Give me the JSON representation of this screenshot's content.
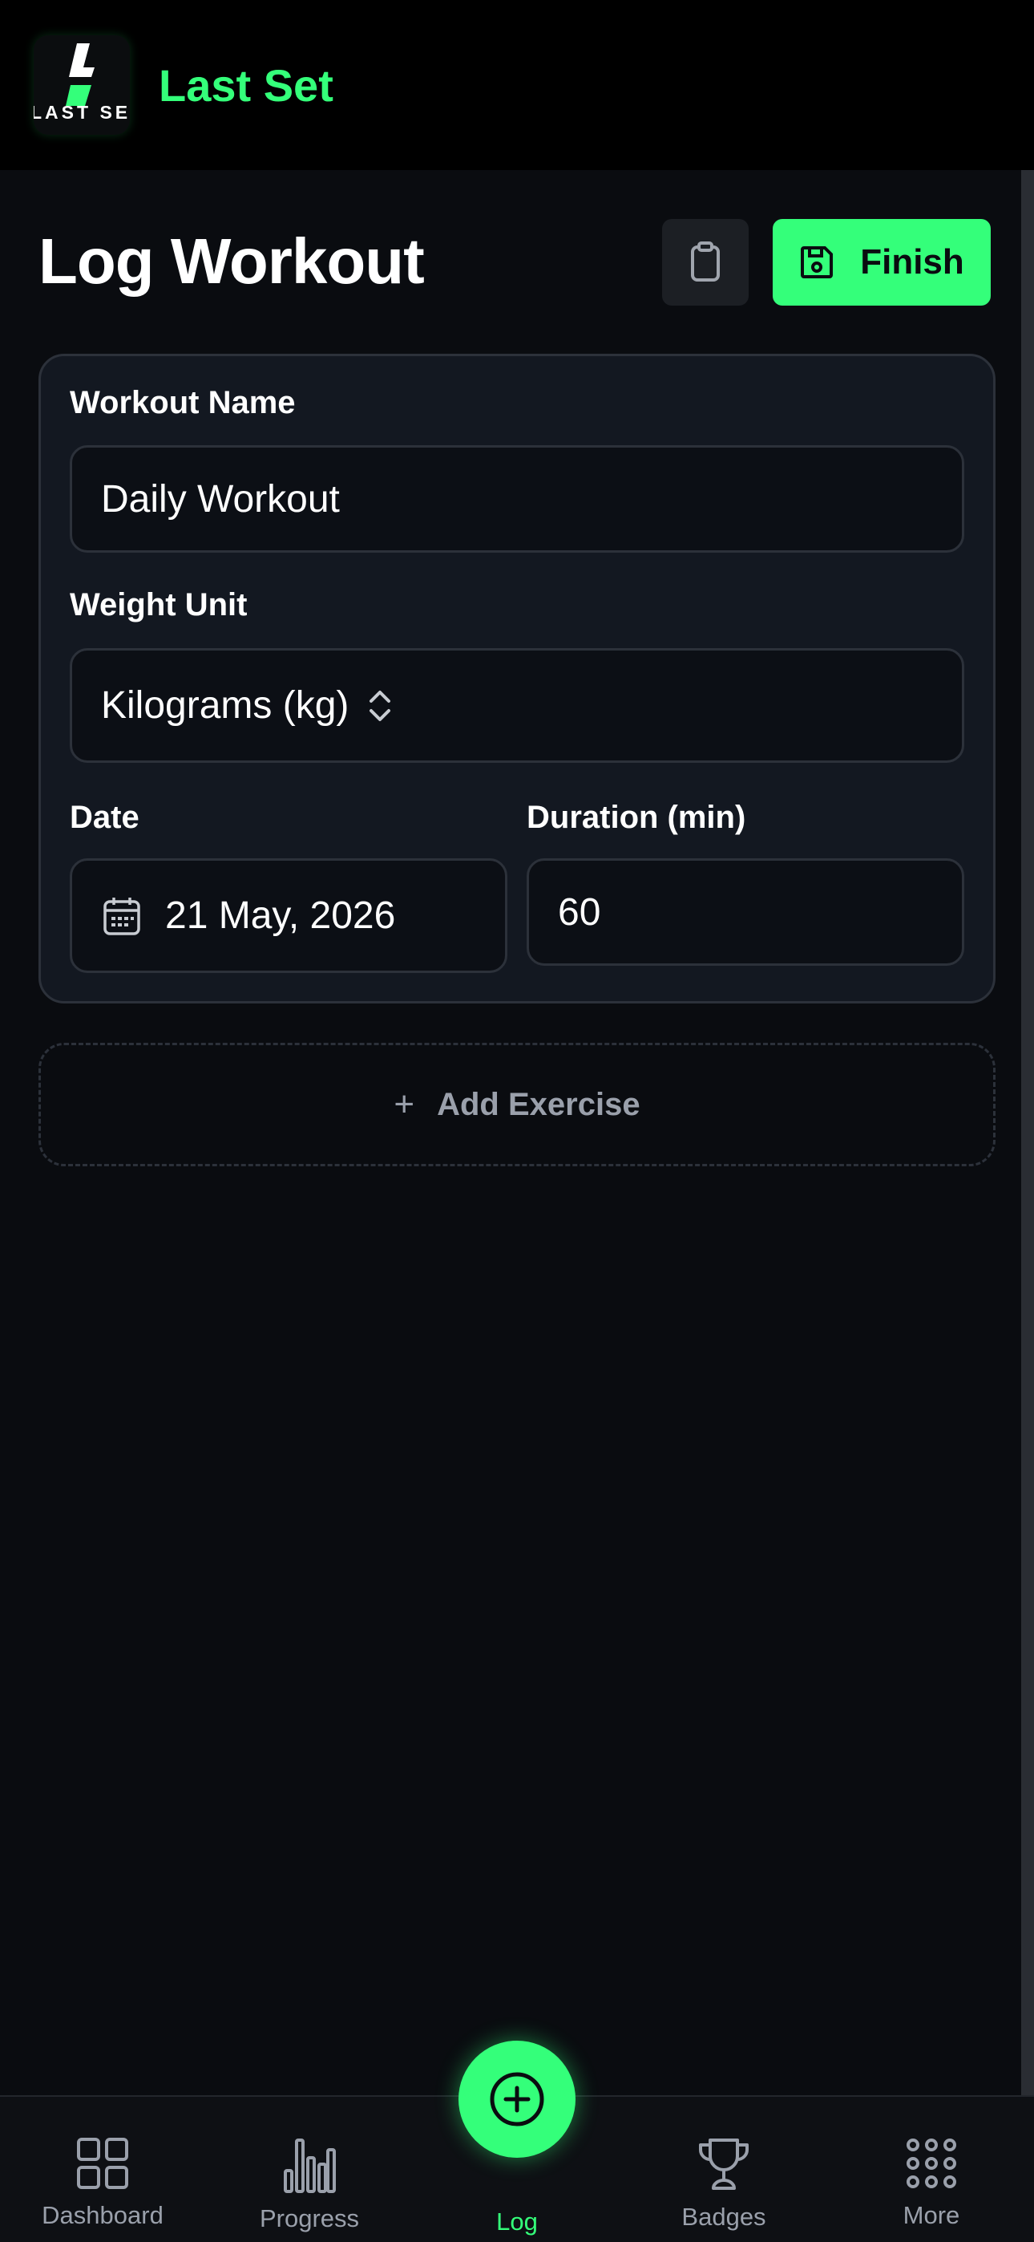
{
  "app": {
    "brand_name": "Last Set",
    "logo_text": "LAST SET"
  },
  "page": {
    "title": "Log Workout",
    "finish_label": "Finish"
  },
  "form": {
    "workout_name_label": "Workout Name",
    "workout_name_value": "Daily Workout",
    "weight_unit_label": "Weight Unit",
    "weight_unit_value": "Kilograms (kg)",
    "date_label": "Date",
    "date_value": "21 May, 2026",
    "duration_label": "Duration (min)",
    "duration_value": "60"
  },
  "add_exercise_label": "Add Exercise",
  "nav": {
    "items": [
      {
        "label": "Dashboard",
        "icon": "grid-icon"
      },
      {
        "label": "Progress",
        "icon": "bar-chart-icon"
      },
      {
        "label": "Log",
        "icon": "plus-circle-icon",
        "active": true
      },
      {
        "label": "Badges",
        "icon": "trophy-icon"
      },
      {
        "label": "More",
        "icon": "dots-grid-icon"
      }
    ]
  },
  "colors": {
    "accent": "#34ff7a",
    "background": "#0a0c10",
    "card": "#131821",
    "muted_text": "#9aa0ab"
  }
}
